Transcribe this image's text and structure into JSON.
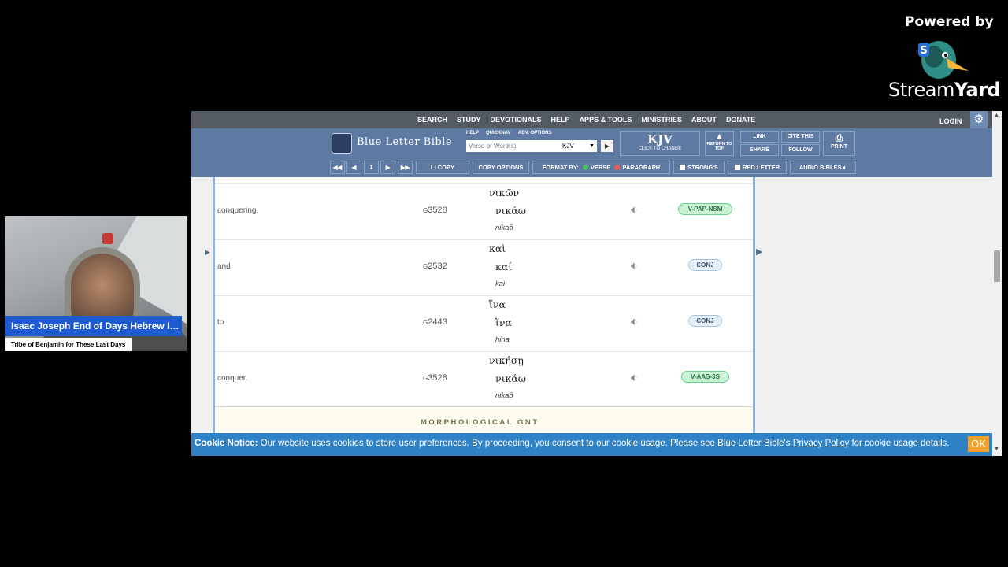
{
  "streamyard": {
    "powered_by": "Powered by",
    "brand_light": "Stream",
    "brand_bold": "Yard"
  },
  "webcam": {
    "name": "Isaac Joseph End of Days Hebrew Isr…",
    "subtitle": "Tribe of Benjamin for These Last Days"
  },
  "topnav": {
    "links": [
      "SEARCH",
      "STUDY",
      "DEVOTIONALS",
      "HELP",
      "APPS & TOOLS",
      "MINISTRIES",
      "ABOUT",
      "DONATE"
    ],
    "login": "LOGIN"
  },
  "blb": {
    "logo": "Blue Letter Bible",
    "help": "HELP",
    "quicknav": "QUICKNAV",
    "adv_options": "ADV. OPTIONS",
    "search_placeholder": "Verse or Word(s)",
    "version": "KJV",
    "kjv_big": "KJV",
    "kjv_small": "CLICK TO CHANGE",
    "return_top": "RETURN TO TOP",
    "link": "LINK",
    "share": "SHARE",
    "cite": "CITE THIS",
    "follow": "FOLLOW",
    "print": "PRINT"
  },
  "toolbar": {
    "copy": "COPY",
    "copy_options": "COPY OPTIONS",
    "format_by": "FORMAT BY:",
    "verse": "VERSE",
    "paragraph": "PARAGRAPH",
    "strongs": "STRONG'S",
    "red_letter": "RED LETTER",
    "audio_bibles": "AUDIO BIBLES"
  },
  "rows": [
    {
      "english": "conquering,",
      "prefix": "G",
      "strongs": "3528",
      "greek_inflected": "νικῶν",
      "greek_lemma": "νικάω",
      "translit": "nikaō",
      "tag": "V-PAP-NSM",
      "tag_color": "#c9f3d4"
    },
    {
      "english": "and",
      "prefix": "G",
      "strongs": "2532",
      "greek_inflected": "καὶ",
      "greek_lemma": "καί",
      "translit": "kai",
      "tag": "CONJ",
      "tag_color": "#e2eef8"
    },
    {
      "english": "to",
      "prefix": "G",
      "strongs": "2443",
      "greek_inflected": "ἵνα",
      "greek_lemma": "ἵνα",
      "translit": "hina",
      "tag": "CONJ",
      "tag_color": "#e2eef8"
    },
    {
      "english": "conquer.",
      "prefix": "G",
      "strongs": "3528",
      "greek_inflected": "νικήσῃ",
      "greek_lemma": "νικάω",
      "translit": "nikaō",
      "tag": "V-AAS-3S",
      "tag_color": "#c9f3d4"
    }
  ],
  "morph_heading": "MORPHOLOGICAL GNT",
  "cookie": {
    "label": "Cookie Notice:",
    "text_before": " Our website uses cookies to store user preferences. By proceeding, you consent to our cookie usage. Please see Blue Letter Bible's ",
    "link": "Privacy Policy",
    "text_after": " for cookie usage details.",
    "ok": "OK"
  },
  "colors": {
    "nav_bg": "#545a62",
    "blb_bar": "#5e7aa3",
    "cookie_bg": "#2f82c6",
    "ok_btn": "#f2a22c",
    "name_tag": "#1f5bd0"
  }
}
